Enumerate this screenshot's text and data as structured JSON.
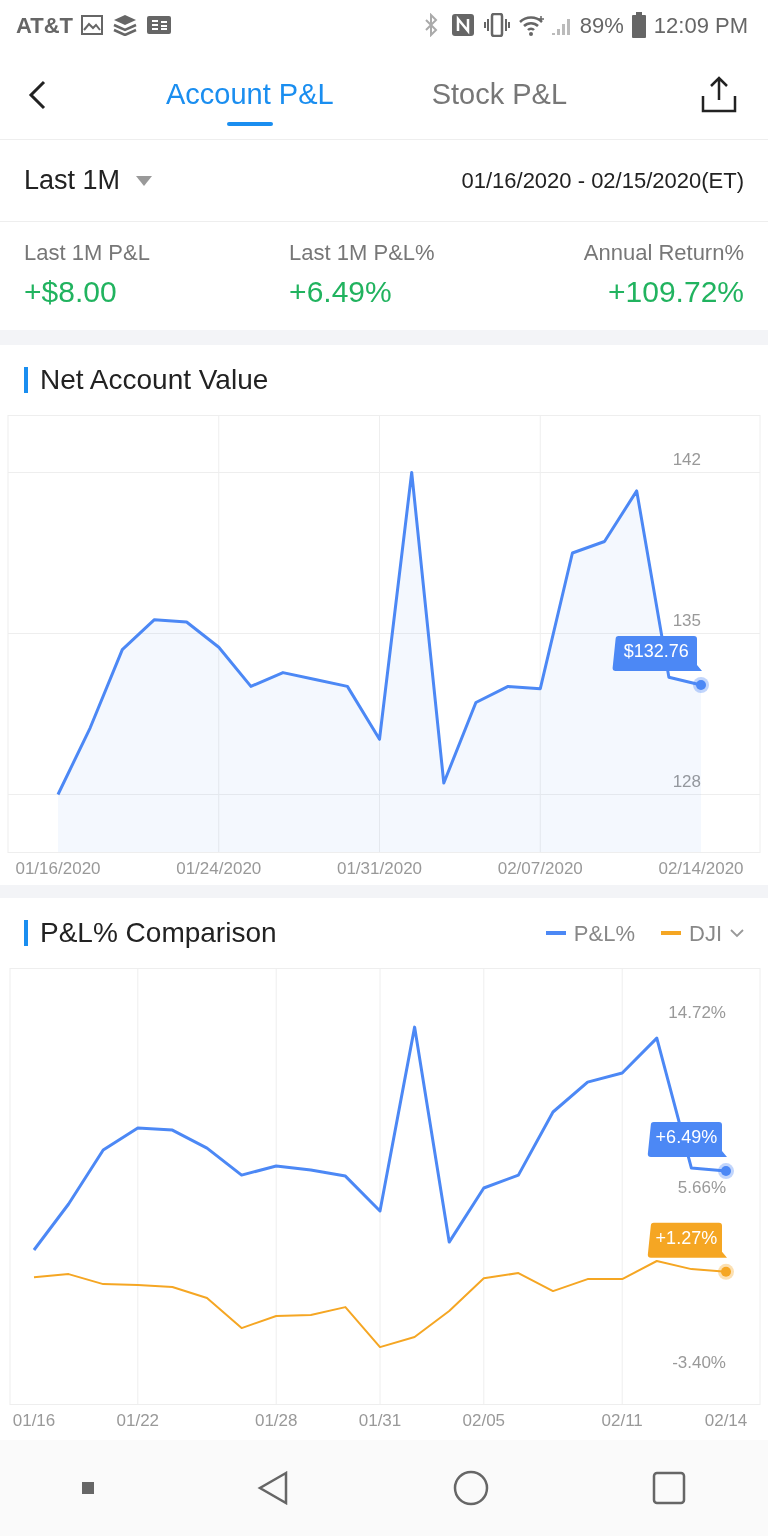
{
  "status_bar": {
    "carrier": "AT&T",
    "battery": "89%",
    "time": "12:09 PM"
  },
  "tabs": [
    {
      "label": "Account P&L",
      "selected": true
    },
    {
      "label": "Stock P&L",
      "selected": false
    }
  ],
  "period": {
    "label": "Last 1M",
    "range": "01/16/2020 - 02/15/2020(ET)"
  },
  "stats": [
    {
      "label": "Last 1M P&L",
      "value": "+$8.00"
    },
    {
      "label": "Last 1M P&L%",
      "value": "+6.49%"
    },
    {
      "label": "Annual Return%",
      "value": "+109.72%"
    }
  ],
  "net_value": {
    "title": "Net Account Value",
    "chart_data": {
      "type": "area",
      "grid": true,
      "categories": [
        "01/16/2020",
        null,
        null,
        null,
        null,
        "01/24/2020",
        null,
        null,
        null,
        null,
        "01/31/2020",
        null,
        null,
        null,
        null,
        "02/07/2020",
        null,
        null,
        null,
        null,
        "02/14/2020"
      ],
      "series": [
        {
          "color": "#4c88f5",
          "values": [
            128.0,
            130.9,
            134.3,
            135.6,
            135.5,
            134.4,
            132.7,
            133.3,
            133.0,
            132.7,
            130.4,
            142.0,
            128.5,
            132.0,
            132.7,
            132.6,
            138.5,
            139.0,
            141.2,
            133.1,
            132.76
          ]
        }
      ],
      "ylim": [
        125.5,
        144.5
      ],
      "yticks": [
        128,
        135,
        142
      ],
      "annotations": [
        "$132.76"
      ]
    }
  },
  "comparison": {
    "title": "P&L% Comparison",
    "chart_data": {
      "type": "line",
      "grid": true,
      "categories": [
        "01/16",
        null,
        null,
        "01/22",
        null,
        null,
        null,
        "01/28",
        null,
        null,
        "01/31",
        null,
        null,
        "02/05",
        null,
        null,
        null,
        "02/11",
        null,
        null,
        "02/14"
      ],
      "series": [
        {
          "name": "P&L%",
          "color": "#4c88f5",
          "values": [
            2.4,
            4.78,
            7.58,
            8.72,
            8.61,
            7.68,
            6.28,
            6.75,
            6.54,
            6.23,
            4.42,
            13.95,
            2.81,
            5.61,
            6.28,
            9.55,
            11.1,
            11.57,
            13.38,
            6.64,
            6.49
          ]
        },
        {
          "name": "DJI",
          "color": "#f5a623",
          "values": [
            0.99,
            1.15,
            0.63,
            0.58,
            0.48,
            -0.09,
            -1.65,
            -1.02,
            -0.97,
            -0.56,
            -2.63,
            -2.11,
            -0.76,
            0.94,
            1.2,
            0.27,
            0.89,
            0.89,
            1.83,
            1.41,
            1.27
          ]
        }
      ],
      "ylim": [
        -5.58,
        17.01
      ],
      "yticks": [
        {
          "value": 14.72,
          "label": "14.72%"
        },
        {
          "value": 5.66,
          "label": "5.66%"
        },
        {
          "value": -3.4,
          "label": "-3.40%"
        }
      ],
      "annotations": [
        "+6.49%",
        "+1.27%"
      ]
    }
  }
}
